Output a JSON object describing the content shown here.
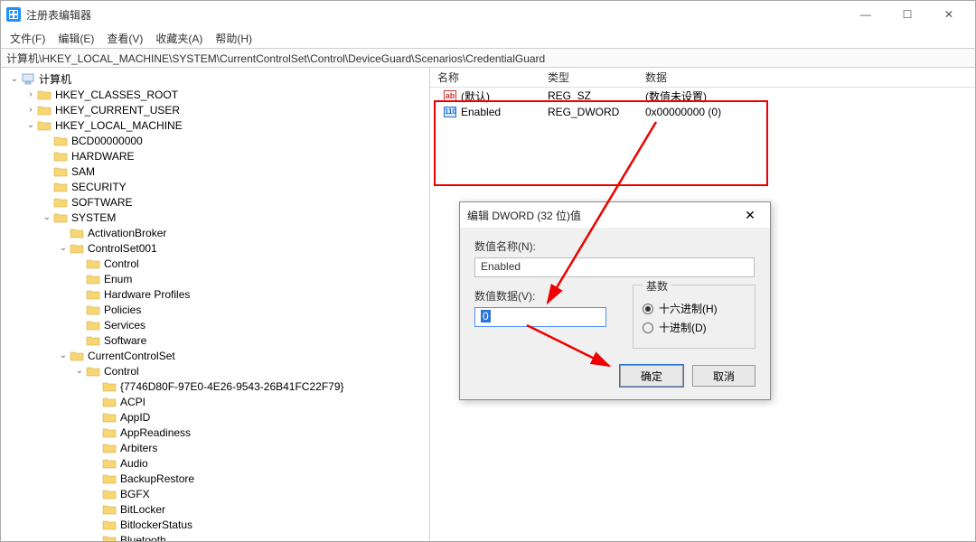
{
  "window": {
    "title": "注册表编辑器",
    "min": "—",
    "max": "☐",
    "close": "✕"
  },
  "menu": {
    "file": "文件(F)",
    "edit": "编辑(E)",
    "view": "查看(V)",
    "favorites": "收藏夹(A)",
    "help": "帮助(H)"
  },
  "path": "计算机\\HKEY_LOCAL_MACHINE\\SYSTEM\\CurrentControlSet\\Control\\DeviceGuard\\Scenarios\\CredentialGuard",
  "tree": [
    {
      "d": 0,
      "e": "v",
      "t": "pc",
      "label": "计算机",
      "sel": false
    },
    {
      "d": 1,
      "e": ">",
      "t": "f",
      "label": "HKEY_CLASSES_ROOT"
    },
    {
      "d": 1,
      "e": ">",
      "t": "f",
      "label": "HKEY_CURRENT_USER"
    },
    {
      "d": 1,
      "e": "v",
      "t": "f",
      "label": "HKEY_LOCAL_MACHINE"
    },
    {
      "d": 2,
      "e": "",
      "t": "f",
      "label": "BCD00000000"
    },
    {
      "d": 2,
      "e": "",
      "t": "f",
      "label": "HARDWARE"
    },
    {
      "d": 2,
      "e": "",
      "t": "f",
      "label": "SAM"
    },
    {
      "d": 2,
      "e": "",
      "t": "f",
      "label": "SECURITY"
    },
    {
      "d": 2,
      "e": "",
      "t": "f",
      "label": "SOFTWARE"
    },
    {
      "d": 2,
      "e": "v",
      "t": "f",
      "label": "SYSTEM"
    },
    {
      "d": 3,
      "e": "",
      "t": "f",
      "label": "ActivationBroker"
    },
    {
      "d": 3,
      "e": "v",
      "t": "f",
      "label": "ControlSet001"
    },
    {
      "d": 4,
      "e": "",
      "t": "f",
      "label": "Control"
    },
    {
      "d": 4,
      "e": "",
      "t": "f",
      "label": "Enum"
    },
    {
      "d": 4,
      "e": "",
      "t": "f",
      "label": "Hardware Profiles"
    },
    {
      "d": 4,
      "e": "",
      "t": "f",
      "label": "Policies"
    },
    {
      "d": 4,
      "e": "",
      "t": "f",
      "label": "Services"
    },
    {
      "d": 4,
      "e": "",
      "t": "f",
      "label": "Software"
    },
    {
      "d": 3,
      "e": "v",
      "t": "f",
      "label": "CurrentControlSet"
    },
    {
      "d": 4,
      "e": "v",
      "t": "f",
      "label": "Control"
    },
    {
      "d": 5,
      "e": "",
      "t": "f",
      "label": "{7746D80F-97E0-4E26-9543-26B41FC22F79}"
    },
    {
      "d": 5,
      "e": "",
      "t": "f",
      "label": "ACPI"
    },
    {
      "d": 5,
      "e": "",
      "t": "f",
      "label": "AppID"
    },
    {
      "d": 5,
      "e": "",
      "t": "f",
      "label": "AppReadiness"
    },
    {
      "d": 5,
      "e": "",
      "t": "f",
      "label": "Arbiters"
    },
    {
      "d": 5,
      "e": "",
      "t": "f",
      "label": "Audio"
    },
    {
      "d": 5,
      "e": "",
      "t": "f",
      "label": "BackupRestore"
    },
    {
      "d": 5,
      "e": "",
      "t": "f",
      "label": "BGFX"
    },
    {
      "d": 5,
      "e": "",
      "t": "f",
      "label": "BitLocker"
    },
    {
      "d": 5,
      "e": "",
      "t": "f",
      "label": "BitlockerStatus"
    },
    {
      "d": 5,
      "e": "",
      "t": "f",
      "label": "Bluetooth"
    }
  ],
  "list": {
    "headers": {
      "name": "名称",
      "type": "类型",
      "data": "数据"
    },
    "rows": [
      {
        "icon": "ab",
        "name": "(默认)",
        "type": "REG_SZ",
        "data": "(数值未设置)"
      },
      {
        "icon": "dw",
        "name": "Enabled",
        "type": "REG_DWORD",
        "data": "0x00000000 (0)"
      }
    ]
  },
  "dialog": {
    "title": "编辑 DWORD (32 位)值",
    "name_label": "数值名称(N):",
    "name_value": "Enabled",
    "data_label": "数值数据(V):",
    "data_value": "0",
    "radix_label": "基数",
    "radix_hex": "十六进制(H)",
    "radix_dec": "十进制(D)",
    "ok": "确定",
    "cancel": "取消",
    "close": "✕"
  }
}
